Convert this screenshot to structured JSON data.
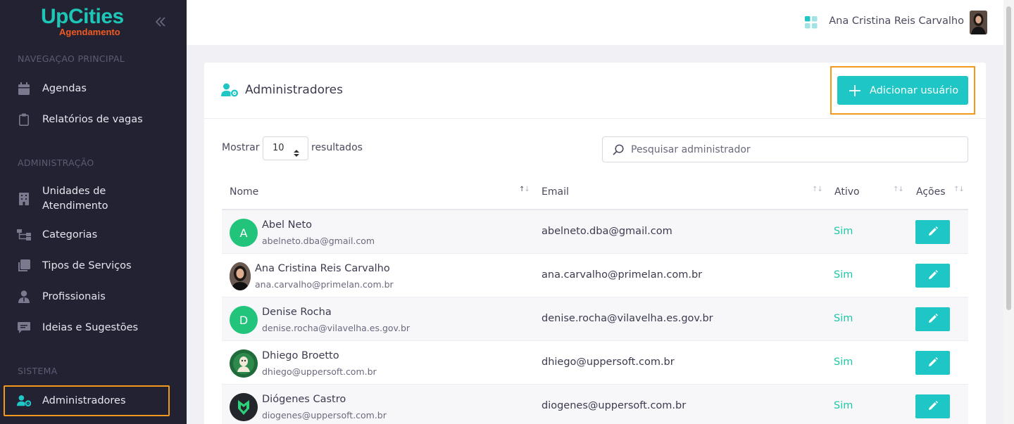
{
  "brand": {
    "name": "UpCities",
    "subtitle": "Agendamento",
    "primary_color": "#1ec6b8",
    "accent_color": "#f05a22"
  },
  "sidebar": {
    "sections": [
      {
        "title": "NAVEGAÇAO PRINCIPAL",
        "items": [
          {
            "label": "Agendas",
            "icon": "calendar-icon"
          },
          {
            "label": "Relatórios de vagas",
            "icon": "clipboard-icon"
          }
        ]
      },
      {
        "title": "ADMINISTRAÇÃO",
        "items": [
          {
            "label_line1": "Unidades de",
            "label_line2": "Atendimento",
            "icon": "building-icon"
          },
          {
            "label": "Categorias",
            "icon": "sitemap-icon"
          },
          {
            "label": "Tipos de Serviços",
            "icon": "layers-icon"
          },
          {
            "label": "Profissionais",
            "icon": "user-tie-icon"
          },
          {
            "label": "Ideias e Sugestões",
            "icon": "comment-icon"
          }
        ]
      },
      {
        "title": "SISTEMA",
        "items": [
          {
            "label": "Administradores",
            "icon": "users-cog-icon",
            "active": true
          }
        ]
      }
    ]
  },
  "topbar": {
    "user_name": "Ana Cristina Reis Carvalho"
  },
  "page": {
    "title": "Administradores",
    "add_button": "Adicionar usuário",
    "show_label": "Mostrar",
    "page_size": "10",
    "results_label": "resultados",
    "search_placeholder": "Pesquisar administrador"
  },
  "table": {
    "columns": [
      "Nome",
      "Email",
      "Ativo",
      "Ações"
    ],
    "rows": [
      {
        "initial": "A",
        "name": "Abel Neto",
        "sub": "abelneto.dba@gmail.com",
        "email": "abelneto.dba@gmail.com",
        "active": "Sim"
      },
      {
        "initial": "",
        "name": "Ana Cristina Reis Carvalho",
        "sub": "ana.carvalho@primelan.com.br",
        "email": "ana.carvalho@primelan.com.br",
        "active": "Sim"
      },
      {
        "initial": "D",
        "name": "Denise Rocha",
        "sub": "denise.rocha@vilavelha.es.gov.br",
        "email": "denise.rocha@vilavelha.es.gov.br",
        "active": "Sim"
      },
      {
        "initial": "",
        "name": "Dhiego Broetto",
        "sub": "dhiego@uppersoft.com.br",
        "email": "dhiego@uppersoft.com.br",
        "active": "Sim"
      },
      {
        "initial": "",
        "name": "Diógenes Castro",
        "sub": "diogenes@uppersoft.com.br",
        "email": "diogenes@uppersoft.com.br",
        "active": "Sim"
      }
    ]
  }
}
